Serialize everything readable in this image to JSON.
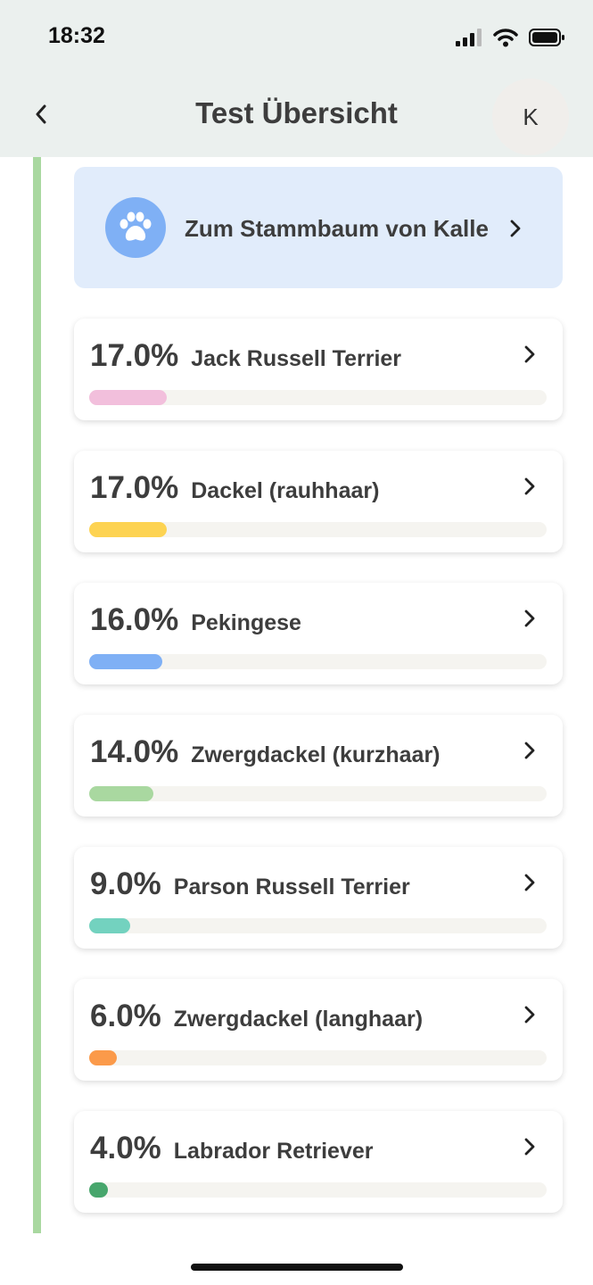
{
  "status_bar": {
    "time": "18:32"
  },
  "nav": {
    "title": "Test Übersicht",
    "avatar_initial": "K"
  },
  "pedigree": {
    "label": "Zum Stammbaum von Kalle",
    "color": "#7fb0f5"
  },
  "breeds": [
    {
      "percent": "17.0%",
      "fraction": 0.17,
      "name": "Jack Russell Terrier",
      "color": "#f2bfdc"
    },
    {
      "percent": "17.0%",
      "fraction": 0.17,
      "name": "Dackel (rauhhaar)",
      "color": "#fdd352"
    },
    {
      "percent": "16.0%",
      "fraction": 0.16,
      "name": "Pekingese",
      "color": "#7fb0f5"
    },
    {
      "percent": "14.0%",
      "fraction": 0.14,
      "name": "Zwergdackel (kurzhaar)",
      "color": "#a9d8a0"
    },
    {
      "percent": "9.0%",
      "fraction": 0.09,
      "name": "Parson Russell Terrier",
      "color": "#73d2bf"
    },
    {
      "percent": "6.0%",
      "fraction": 0.06,
      "name": "Zwergdackel (langhaar)",
      "color": "#fb9a4a"
    },
    {
      "percent": "4.0%",
      "fraction": 0.04,
      "name": "Labrador Retriever",
      "color": "#47a66c"
    }
  ]
}
